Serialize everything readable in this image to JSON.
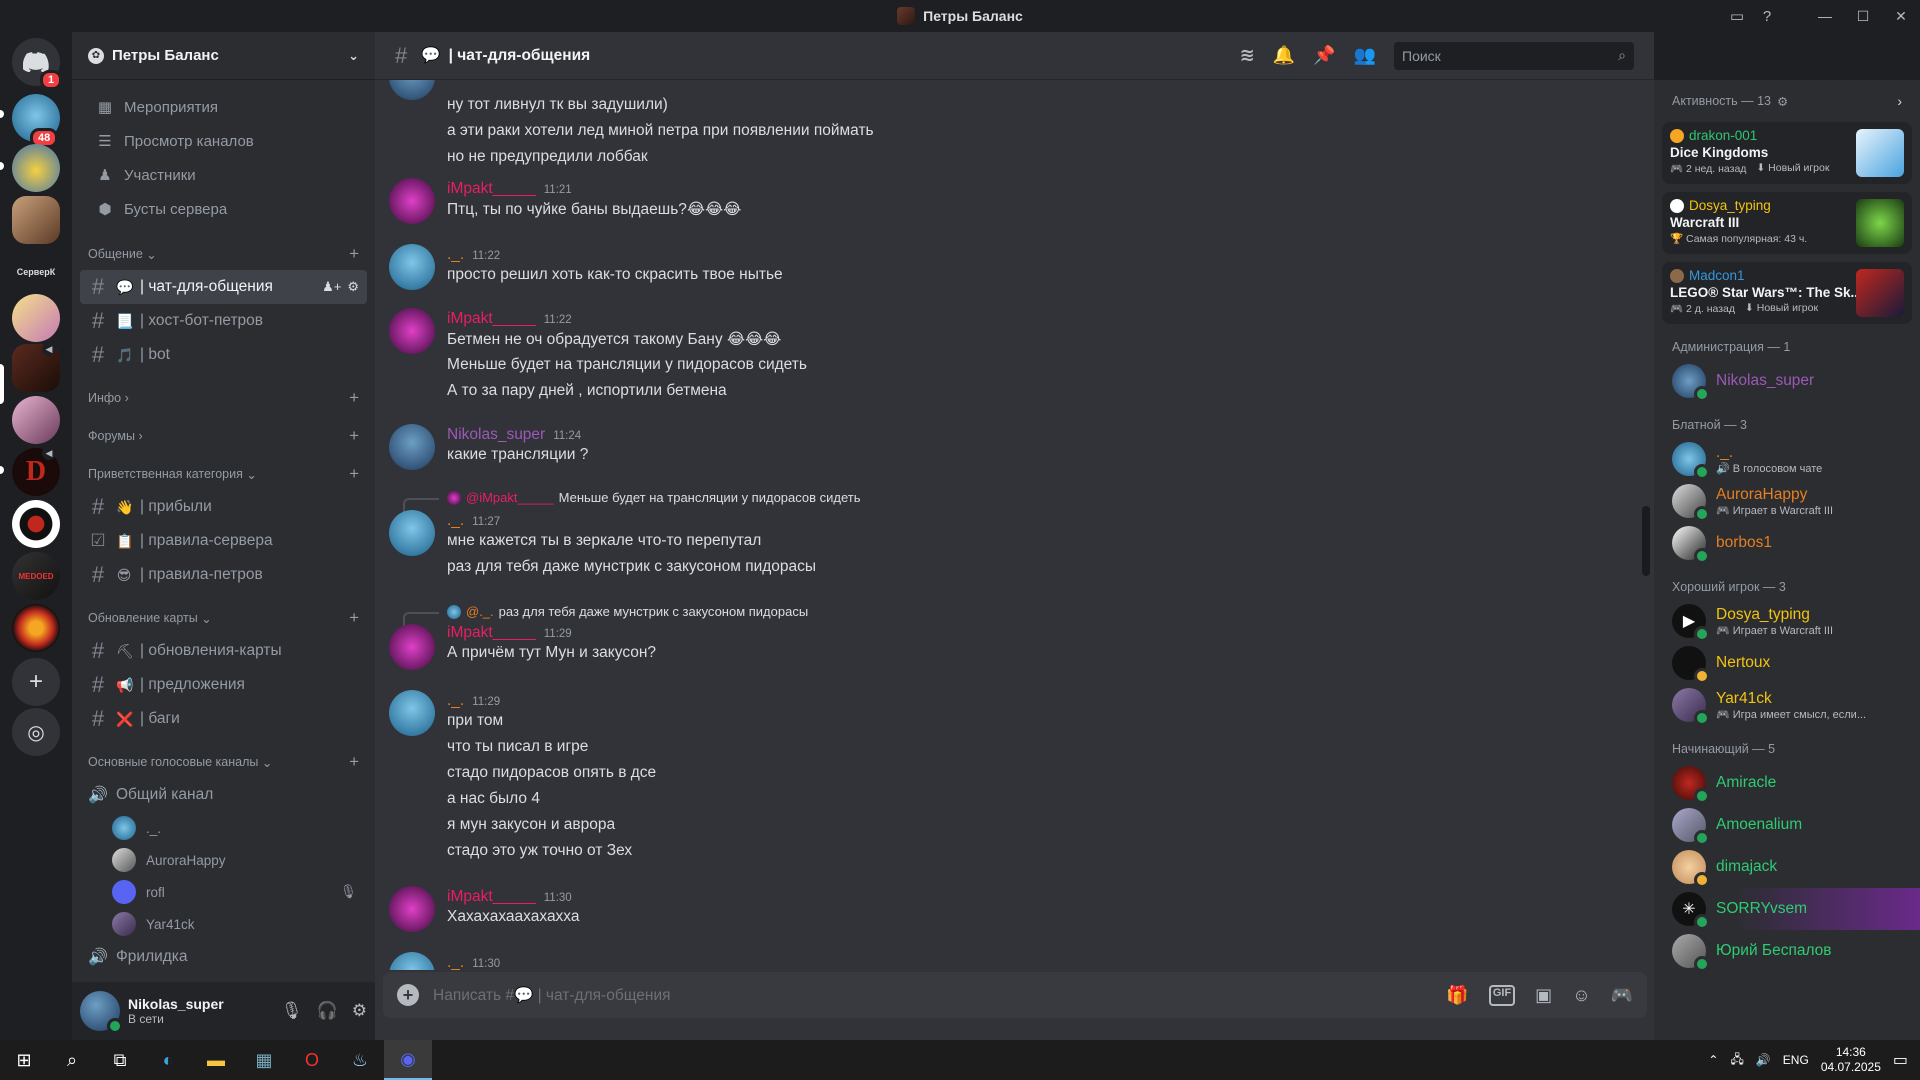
{
  "window": {
    "title": "Петры Баланс"
  },
  "rail": {
    "home_badge": "1",
    "dm_badge": "48",
    "server_text": "СерверК"
  },
  "guild": {
    "name": "Петры Баланс"
  },
  "top_items": [
    {
      "label": "Мероприятия",
      "icon": "calendar-icon"
    },
    {
      "label": "Просмотр каналов",
      "icon": "browse-icon"
    },
    {
      "label": "Участники",
      "icon": "members-icon"
    },
    {
      "label": "Бусты сервера",
      "icon": "boost-icon"
    }
  ],
  "categories": {
    "c1": "Общение",
    "c2": "Инфо",
    "c3": "Форумы",
    "c4": "Приветственная категория",
    "c5": "Обновление карты",
    "c6": "Основные голосовые каналы"
  },
  "channels": {
    "chat": {
      "emoji": "💬",
      "name": "| чат-для-общения"
    },
    "host": {
      "emoji": "📃",
      "name": "| хост-бот-петров"
    },
    "bot": {
      "emoji": "🎵",
      "name": "| bot"
    },
    "arrived": {
      "emoji": "👋",
      "name": "| прибыли"
    },
    "rules": {
      "emoji": "📋",
      "name": "| правила-сервера"
    },
    "rules2": {
      "emoji": "😎",
      "name": "| правила-петров"
    },
    "updates": {
      "emoji": "⛏",
      "name": "| обновления-карты"
    },
    "suggest": {
      "emoji": "📢",
      "name": "| предложения"
    },
    "bugs": {
      "emoji": "❌",
      "name": "| баги"
    },
    "voice": {
      "name": "Общий канал"
    },
    "next_voice": {
      "name": "Фрилидка"
    }
  },
  "voice_users": [
    "._.",
    "AuroraHappy",
    "rofl",
    "Yar41ck"
  ],
  "user_panel": {
    "name": "Nikolas_super",
    "status": "В сети"
  },
  "chat_header": {
    "emoji": "💬",
    "name": "| чат-для-общения",
    "search_placeholder": "Поиск"
  },
  "messages": [
    {
      "lines": [
        "ну тот ливнул тк вы задушили)",
        "а эти раки хотели лед миной петра при появлении поймать",
        "но не предупредили лоббак"
      ]
    },
    {
      "author": "iMpakt_____",
      "time": "11:21",
      "lines": [
        "Птц, ты по чуйке баны выдаешь?😂😂😂"
      ]
    },
    {
      "author": "._.",
      "time": "11:22",
      "lines": [
        "просто решил хоть как-то скрасить твое нытье"
      ]
    },
    {
      "author": "iMpakt_____",
      "time": "11:22",
      "lines": [
        "Бетмен не оч обрадуется такому Бану 😂😂😂",
        "Меньше будет на трансляции у пидорасов сидеть",
        "А то за пару дней , испортили бетмена"
      ]
    },
    {
      "author": "Nikolas_super",
      "time": "11:24",
      "lines": [
        "какие трансляции ?"
      ]
    },
    {
      "reply_to": "@iMpakt_____",
      "reply_text": "Меньше будет на трансляции у пидорасов сидеть",
      "author": "._.",
      "time": "11:27",
      "lines": [
        "мне кажется ты в зеркале что-то перепутал",
        "раз для тебя даже мунстрик с закусоном пидорасы"
      ]
    },
    {
      "reply_to": "@._.",
      "reply_text": "раз для тебя даже мунстрик с закусоном пидорасы",
      "author": "iMpakt_____",
      "time": "11:29",
      "lines": [
        "А причём тут Мун и закусон?"
      ]
    },
    {
      "author": "._.",
      "time": "11:29",
      "lines": [
        "при том",
        "что ты писал в игре",
        "стадо пидорасов опять в дсе",
        "а нас было 4",
        "я мун закусон и аврора",
        "стадо это уж точно от Зех"
      ]
    },
    {
      "author": "iMpakt_____",
      "time": "11:30",
      "lines": [
        "Хахахахаахахахха"
      ]
    },
    {
      "author": "._.",
      "time": "11:30",
      "lines": []
    }
  ],
  "composer": {
    "placeholder": "Написать #💬 | чат-для-общения"
  },
  "members": {
    "activity_header": "Активность — 13",
    "activities": [
      {
        "user": "drakon-001",
        "game": "Dice Kingdoms",
        "meta1": "2 нед. назад",
        "meta2": "Новый игрок",
        "user_color": "#2dc770"
      },
      {
        "user": "Dosya_typing",
        "game": "Warcraft III",
        "meta1": "Самая популярная: 43 ч.",
        "meta2": "",
        "user_color": "#f1c40f"
      },
      {
        "user": "Madcon1",
        "game": "LEGO® Star Wars™: The Sk...",
        "meta1": "2 д. назад",
        "meta2": "Новый игрок",
        "user_color": "#3498db"
      }
    ],
    "groups": [
      {
        "title": "Администрация — 1",
        "members": [
          {
            "name": "Nikolas_super",
            "sub": "",
            "color": "#9b59b6"
          }
        ]
      },
      {
        "title": "Блатной — 3",
        "members": [
          {
            "name": "._.",
            "sub": "В голосовом чате",
            "color": "#e67e22"
          },
          {
            "name": "AuroraHappy",
            "sub": "Играет в Warcraft III",
            "color": "#e67e22"
          },
          {
            "name": "borbos1",
            "sub": "",
            "color": "#e67e22"
          }
        ]
      },
      {
        "title": "Хороший игрок — 3",
        "members": [
          {
            "name": "Dosya_typing",
            "sub": "Играет в Warcraft III",
            "color": "#f1c40f"
          },
          {
            "name": "Nertoux",
            "sub": "",
            "color": "#f1c40f"
          },
          {
            "name": "Yar41ck",
            "sub": "Игра имеет смысл, если...",
            "color": "#f1c40f"
          }
        ]
      },
      {
        "title": "Начинающий — 5",
        "members": [
          {
            "name": "Amiracle",
            "sub": "",
            "color": "#2ecc71"
          },
          {
            "name": "Amoenalium",
            "sub": "",
            "color": "#2ecc71"
          },
          {
            "name": "dimajack",
            "sub": "",
            "color": "#2ecc71"
          },
          {
            "name": "SORRYvsem",
            "sub": "",
            "color": "#2ecc71"
          },
          {
            "name": "Юрий Беспалов",
            "sub": "",
            "color": "#2ecc71"
          }
        ]
      }
    ]
  },
  "taskbar": {
    "lang": "ENG",
    "time": "14:36",
    "date": "04.07.2025"
  }
}
